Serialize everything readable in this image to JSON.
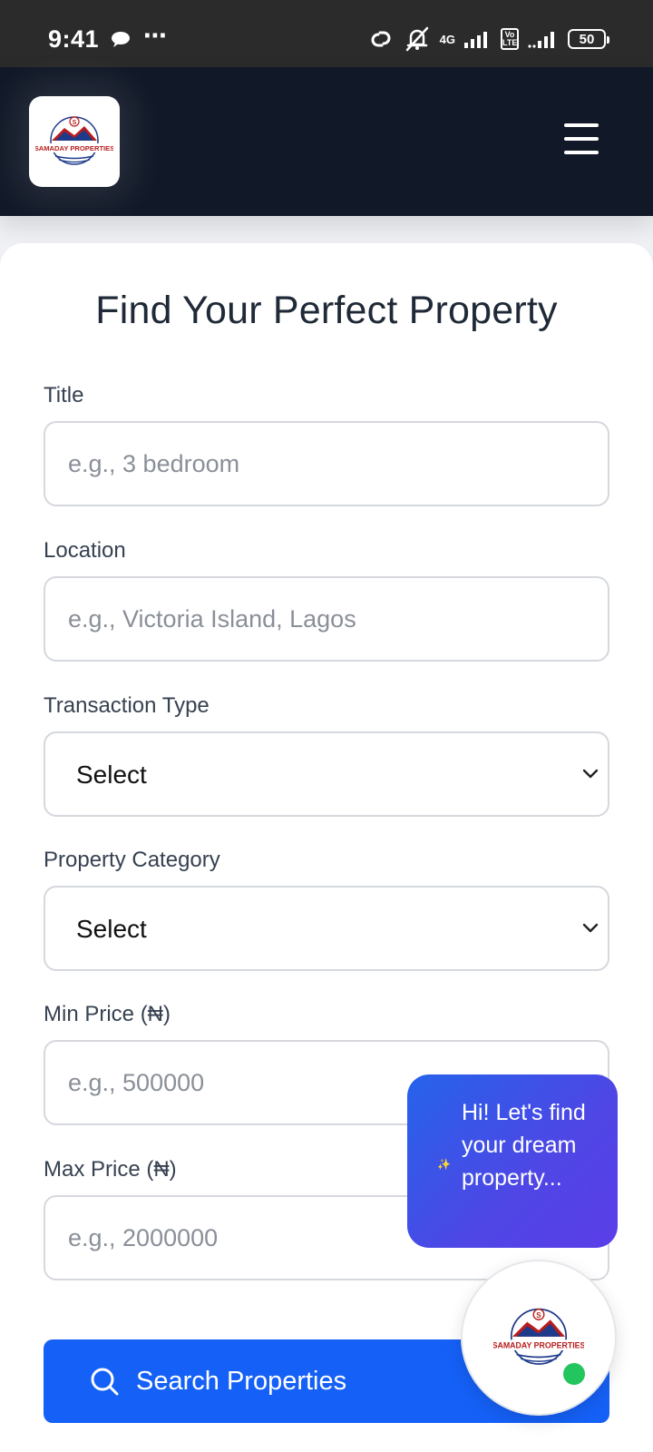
{
  "status_bar": {
    "time": "9:41",
    "dots": "⋯",
    "network_label": "4G",
    "volte_label": "Vo LTE",
    "battery": "50"
  },
  "header": {
    "logo_text": "SAMADAY PROPERTIES",
    "logo_letter": "S"
  },
  "form": {
    "title": "Find Your Perfect Property",
    "title_field": {
      "label": "Title",
      "placeholder": "e.g., 3 bedroom"
    },
    "location_field": {
      "label": "Location",
      "placeholder": "e.g., Victoria Island, Lagos"
    },
    "transaction_type": {
      "label": "Transaction Type",
      "value": "Select"
    },
    "property_category": {
      "label": "Property Category",
      "value": "Select"
    },
    "min_price": {
      "label": "Min Price (₦)",
      "placeholder": "e.g., 500000"
    },
    "max_price": {
      "label": "Max Price (₦)",
      "placeholder": "e.g., 2000000"
    },
    "search_button": "Search Properties"
  },
  "chat": {
    "bubble_text": "Hi! Let's find your dream property...",
    "fab_logo_text": "SAMADAY PROPERTIES",
    "fab_logo_letter": "S"
  },
  "colors": {
    "header_bg": "#111827",
    "primary": "#1560f6",
    "online": "#22c55e"
  }
}
